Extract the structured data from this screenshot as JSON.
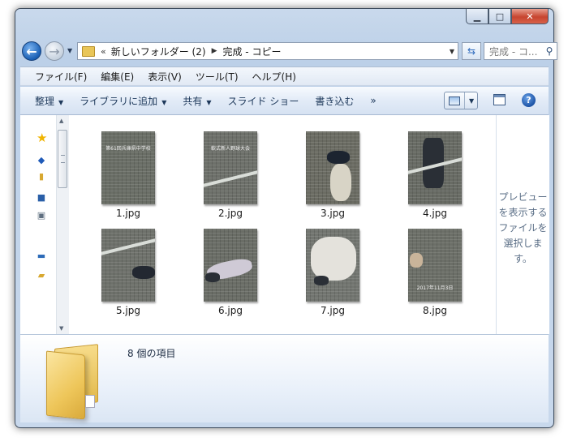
{
  "window": {
    "caption_buttons": {
      "minimize": "▁",
      "maximize": "□",
      "close": "✕"
    }
  },
  "nav": {
    "back_glyph": "←",
    "forward_glyph": "→",
    "breadcrumb_chevron": "«",
    "crumbs": [
      "新しいフォルダー (2)",
      "完成 - コピー"
    ],
    "crumb_separator": "▶",
    "search_placeholder": "完成 - コ...",
    "search_icon": "search-icon",
    "refresh_icon": "refresh-icon"
  },
  "menubar": [
    "ファイル(F)",
    "編集(E)",
    "表示(V)",
    "ツール(T)",
    "ヘルプ(H)"
  ],
  "commandbar": [
    {
      "label": "整理",
      "dropdown": true
    },
    {
      "label": "ライブラリに追加",
      "dropdown": true
    },
    {
      "label": "共有",
      "dropdown": true
    },
    {
      "label": "スライド ショー",
      "dropdown": false
    },
    {
      "label": "書き込む",
      "dropdown": false
    },
    {
      "label": "»",
      "dropdown": false
    }
  ],
  "commandbar_extra": {
    "help_label": "?"
  },
  "nav_pane_icons": [
    "favorites-star-icon",
    "onedrive-icon",
    "libraries-icon",
    "homegroup-icon",
    "computer-icon",
    "network-icon",
    "folder-icon"
  ],
  "files": [
    {
      "name": "1.jpg",
      "caption": "第61回兵庫県中学校"
    },
    {
      "name": "2.jpg",
      "caption": "軟式新人野球大会"
    },
    {
      "name": "3.jpg",
      "caption": ""
    },
    {
      "name": "4.jpg",
      "caption": ""
    },
    {
      "name": "5.jpg",
      "caption": ""
    },
    {
      "name": "6.jpg",
      "caption": ""
    },
    {
      "name": "7.jpg",
      "caption": ""
    },
    {
      "name": "8.jpg",
      "caption": "2017年11月3日"
    }
  ],
  "preview": {
    "text": "プレビューを表示するファイルを選択します。"
  },
  "details": {
    "count_text": "8 個の項目"
  }
}
